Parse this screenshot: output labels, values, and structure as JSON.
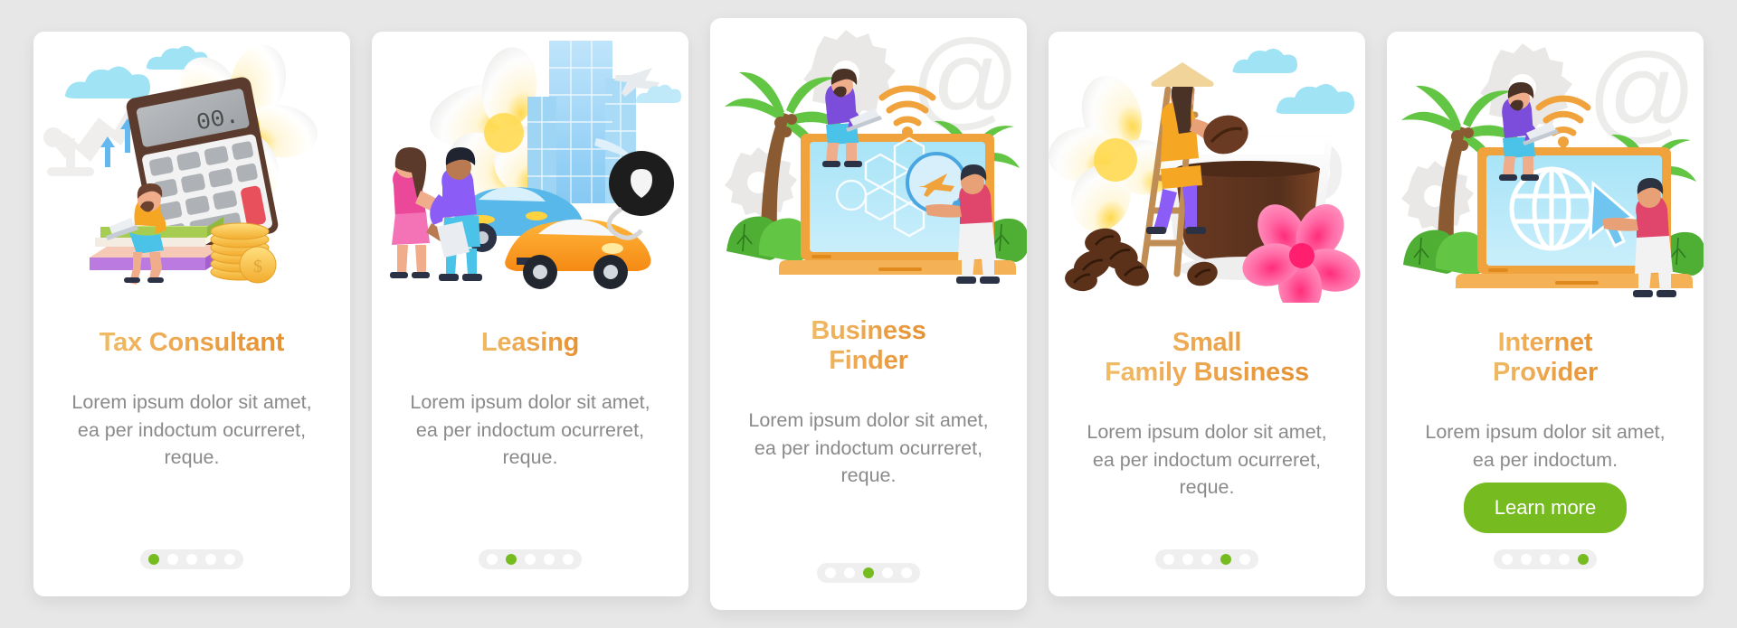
{
  "theme": {
    "page_background": "#e7e7e7",
    "card_background": "#ffffff",
    "title_gradient_from": "#f0c06a",
    "title_gradient_to": "#e18f30",
    "body_text_color": "#8a8a8a",
    "accent_green": "#76bc21",
    "dot_track_color": "#efefef",
    "dot_inactive_color": "#ffffff"
  },
  "screens": [
    {
      "id": "tax-consultant",
      "title": "Tax Consultant",
      "title_lines": [
        "Tax Consultant"
      ],
      "description": "Lorem ipsum dolor sit amet, ea per indoctum ocurreret, reque.",
      "illustration_name": "tax-consultant-illustration",
      "illustration_elements": [
        "man-with-laptop",
        "giant-calculator",
        "stack-of-books",
        "gold-coins",
        "white-plumeria-flower",
        "clouds",
        "growth-arrows"
      ],
      "pagination": {
        "total": 5,
        "active_index": 0
      },
      "cta": null,
      "height_variant": "short"
    },
    {
      "id": "leasing",
      "title": "Leasing",
      "title_lines": [
        "Leasing"
      ],
      "description": "Lorem ipsum dolor sit amet, ea per indoctum ocurreret, reque.",
      "illustration_name": "leasing-illustration",
      "illustration_elements": [
        "handshake-couple",
        "orange-sports-car",
        "blue-car",
        "city-buildings",
        "airplane",
        "car-key-fob",
        "white-plumeria-flower"
      ],
      "pagination": {
        "total": 5,
        "active_index": 1
      },
      "cta": null,
      "height_variant": "short"
    },
    {
      "id": "business-finder",
      "title": "Business Finder",
      "title_lines": [
        "Business",
        "Finder"
      ],
      "description": "Lorem ipsum dolor sit amet, ea per indoctum ocurreret, reque.",
      "illustration_name": "business-finder-illustration",
      "illustration_elements": [
        "laptop",
        "palm-trees",
        "gears",
        "at-symbol",
        "wifi-signal",
        "magnifier-with-plane",
        "man-with-laptop",
        "man-pointing"
      ],
      "pagination": {
        "total": 5,
        "active_index": 2
      },
      "cta": null,
      "height_variant": "tall"
    },
    {
      "id": "small-family-business",
      "title": "Small Family Business",
      "title_lines": [
        "Small",
        "Family Business"
      ],
      "description": "Lorem ipsum dolor sit amet, ea per indoctum ocurreret, reque.",
      "illustration_name": "small-family-business-illustration",
      "illustration_elements": [
        "coffee-cup",
        "woman-on-ladder",
        "coffee-beans",
        "pink-plumeria-flower",
        "white-plumeria-flower",
        "clouds"
      ],
      "pagination": {
        "total": 5,
        "active_index": 3
      },
      "cta": null,
      "height_variant": "short"
    },
    {
      "id": "internet-provider",
      "title": "Internet Provider",
      "title_lines": [
        "Internet",
        "Provider"
      ],
      "description": "Lorem ipsum dolor sit amet, ea per indoctum.",
      "illustration_name": "internet-provider-illustration",
      "illustration_elements": [
        "laptop",
        "globe",
        "cursor-arrow",
        "palm-trees",
        "gears",
        "at-symbol",
        "wifi-signal",
        "man-with-laptop",
        "man-pointing"
      ],
      "pagination": {
        "total": 5,
        "active_index": 4
      },
      "cta": {
        "label": "Learn more"
      },
      "height_variant": "short"
    }
  ]
}
